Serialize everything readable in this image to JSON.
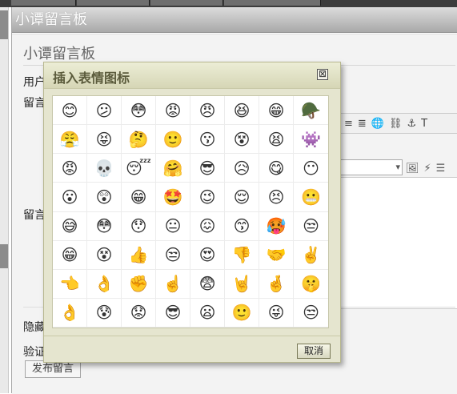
{
  "page": {
    "title": "小谭留言板",
    "subtitle": "小谭留言板",
    "labels": {
      "user": "用户",
      "message": "留言",
      "message2": "留言",
      "hidden": "隐藏",
      "verify": "验证"
    },
    "submit_label": "发布留言",
    "toolbar_icons": [
      "align-center-icon",
      "align-right-icon",
      "link-icon",
      "unlink-icon",
      "anchor-icon",
      "text-color-icon",
      "image-icon",
      "flash-icon",
      "list-icon"
    ]
  },
  "dialog": {
    "title": "插入表情图标",
    "close_label": "⊠",
    "cancel_label": "取消",
    "emoticons": [
      "😊",
      "😕",
      "😳",
      "😡",
      "😠",
      "😆",
      "😁",
      "🪖",
      "😤",
      "😝",
      "🤔",
      "🙂",
      "😗",
      "😵",
      "😫",
      "👾",
      "😡",
      "💀",
      "😴",
      "🤗",
      "😎",
      "😥",
      "😋",
      "😶",
      "😮",
      "😲",
      "😁",
      "🤩",
      "😉",
      "😌",
      "😣",
      "😬",
      "😅",
      "😳",
      "😯",
      "😐",
      "😖",
      "😙",
      "🥵",
      "😒",
      "😁",
      "😵",
      "👍",
      "😒",
      "😍",
      "👎",
      "🤝",
      "✌️",
      "👈",
      "👌",
      "✊",
      "☝️",
      "😨",
      "🤘",
      "🤞",
      "🤫",
      "👌",
      "😰",
      "😟",
      "😎",
      "😦",
      "🙂",
      "😜",
      "😒"
    ]
  },
  "colors": {
    "dialog_bg": "#e5e5cf",
    "dialog_title_text": "#5b5b3c",
    "title_bar": "#a9a9a9"
  }
}
